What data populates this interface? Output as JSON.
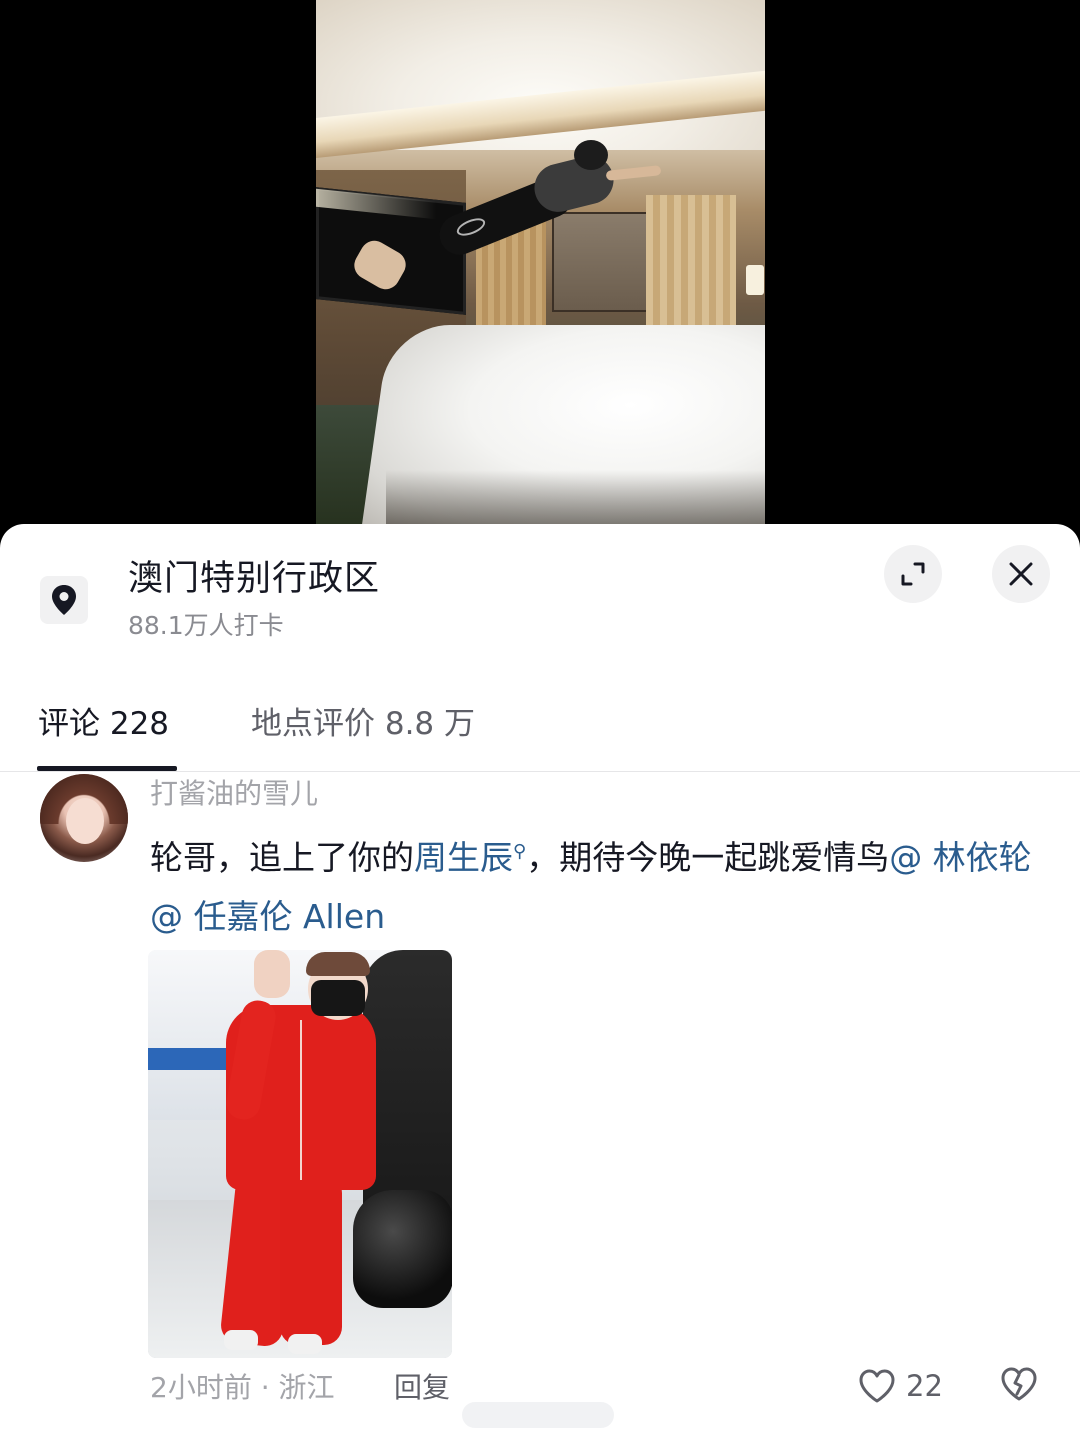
{
  "location": {
    "title": "澳门特别行政区",
    "checkins": "88.1万人打卡",
    "icon": "location-pin-icon"
  },
  "header_buttons": {
    "expand_icon": "expand-icon",
    "close_icon": "close-icon"
  },
  "tabs": [
    {
      "label": "评论 228",
      "active": true
    },
    {
      "label": "地点评价 8.8 万",
      "active": false
    }
  ],
  "comment": {
    "username": "打酱油的雪儿",
    "text_prefix": "轮哥，追上了你的",
    "linked_name": "周生辰",
    "text_middle": "，期待今晚一起跳爱情鸟",
    "mention_1": "@ 林依轮",
    "mention_2": "@ 任嘉伦 Allen",
    "time_location": "2小时前 · 浙江",
    "reply_label": "回复",
    "like_count": "22"
  },
  "colors": {
    "link": "#2a5c8e",
    "text_primary": "#161823",
    "text_secondary": "#a3a4a9"
  }
}
